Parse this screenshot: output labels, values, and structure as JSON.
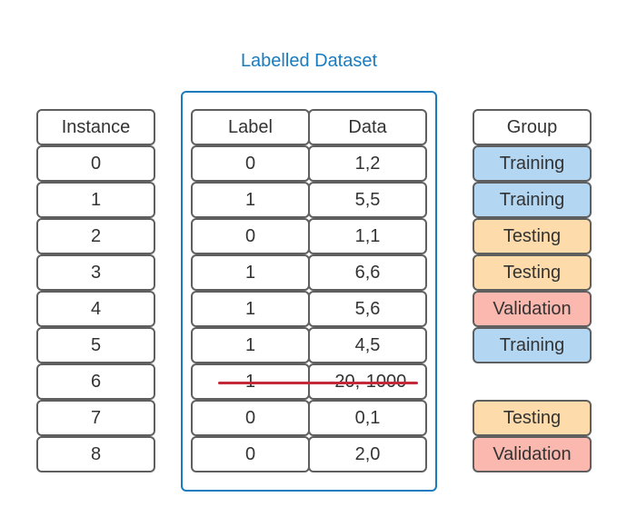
{
  "title": "Labelled Dataset",
  "colors": {
    "dataset_border": "#1a7bbf",
    "training": "#b3d6f2",
    "testing": "#fddbaa",
    "validation": "#fbb8ae",
    "strike": "#c4293a"
  },
  "headers": {
    "instance": "Instance",
    "label": "Label",
    "data": "Data",
    "group": "Group"
  },
  "rows": [
    {
      "instance": "0",
      "label": "0",
      "data": "1,2",
      "group": "Training"
    },
    {
      "instance": "1",
      "label": "1",
      "data": "5,5",
      "group": "Training"
    },
    {
      "instance": "2",
      "label": "0",
      "data": "1,1",
      "group": "Testing"
    },
    {
      "instance": "3",
      "label": "1",
      "data": "6,6",
      "group": "Testing"
    },
    {
      "instance": "4",
      "label": "1",
      "data": "5,6",
      "group": "Validation"
    },
    {
      "instance": "5",
      "label": "1",
      "data": "4,5",
      "group": "Training"
    },
    {
      "instance": "6",
      "label": "1",
      "data": "-20,-1000",
      "group": null,
      "struck_out": true
    },
    {
      "instance": "7",
      "label": "0",
      "data": "0,1",
      "group": "Testing"
    },
    {
      "instance": "8",
      "label": "0",
      "data": "2,0",
      "group": "Validation"
    }
  ]
}
